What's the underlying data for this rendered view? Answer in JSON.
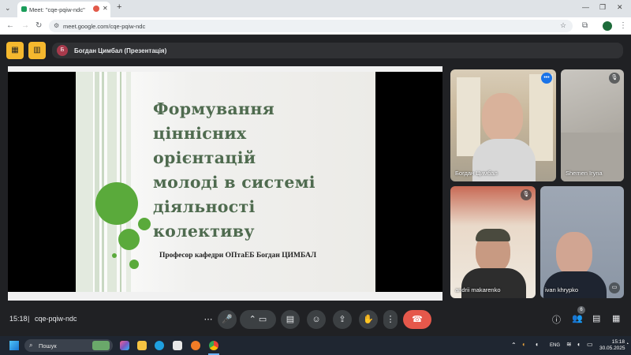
{
  "browser": {
    "tab_title": "Meet: \"cqe-pqiw-ndc\"",
    "url": "meet.google.com/cqe-pqiw-ndc"
  },
  "presenter": {
    "avatar_letter": "Б",
    "label": "Богдан Цимбал (Презентація)"
  },
  "slide": {
    "title": "Формування\nціннісних\nорієнтацій\nмолоді в системі\nдіяльності\nколективу",
    "subtitle": "Професор кафедри ОПтаЕБ Богдан ЦИМБАЛ"
  },
  "participants": [
    {
      "name": "Богдан Цимбал"
    },
    {
      "name": "Shemen Iryna"
    },
    {
      "name": "andrii makarenko"
    },
    {
      "name": "ivan khrypko"
    }
  ],
  "meeting": {
    "time": "15:18",
    "code": "cqe-pqiw-ndc",
    "participant_count": "6"
  },
  "taskbar": {
    "search_label": "Пошук",
    "lang": "ENG",
    "clock_time": "15:18",
    "clock_date": "30.05.2025"
  },
  "colors": {
    "hangup": "#e5584b",
    "accent_yellow": "#f5b82e",
    "slide_title": "#4f6b4f",
    "slide_circle": "#5aaa3b"
  }
}
